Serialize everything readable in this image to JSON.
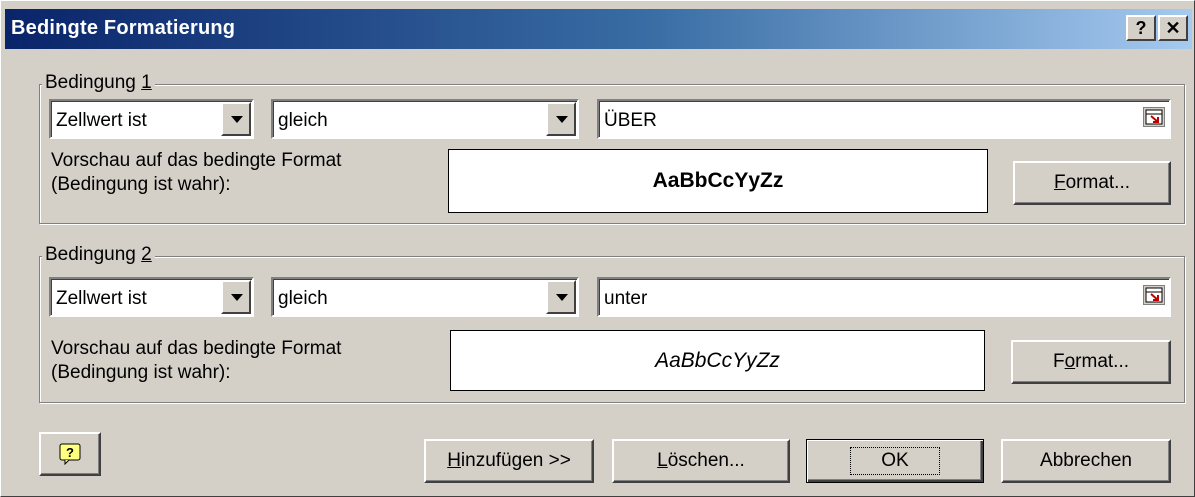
{
  "window": {
    "title": "Bedingte Formatierung",
    "help_glyph": "?",
    "close_glyph": "✕"
  },
  "condition1": {
    "legend_prefix": "Bedingung ",
    "legend_num": "1",
    "type": "Zellwert ist",
    "operator": "gleich",
    "value": "ÜBER",
    "preview_label_line1": "Vorschau auf das bedingte Format",
    "preview_label_line2": "(Bedingung ist wahr):",
    "preview_text": "AaBbCcYyZz",
    "format_button_key": "F",
    "format_button_rest": "ormat..."
  },
  "condition2": {
    "legend_prefix": "Bedingung ",
    "legend_num": "2",
    "type": "Zellwert ist",
    "operator": "gleich",
    "value": "unter",
    "preview_label_line1": "Vorschau auf das bedingte Format",
    "preview_label_line2": "(Bedingung ist wahr):",
    "preview_text": "AaBbCcYyZz",
    "format_button_pre": "F",
    "format_button_key": "o",
    "format_button_rest": "rmat..."
  },
  "buttons": {
    "add_key": "H",
    "add_rest": "inzufügen >>",
    "delete_key": "L",
    "delete_rest": "öschen...",
    "ok": "OK",
    "cancel": "Abbrechen"
  },
  "icons": {
    "help": "help-question-icon",
    "refedit": "range-selector-icon"
  }
}
